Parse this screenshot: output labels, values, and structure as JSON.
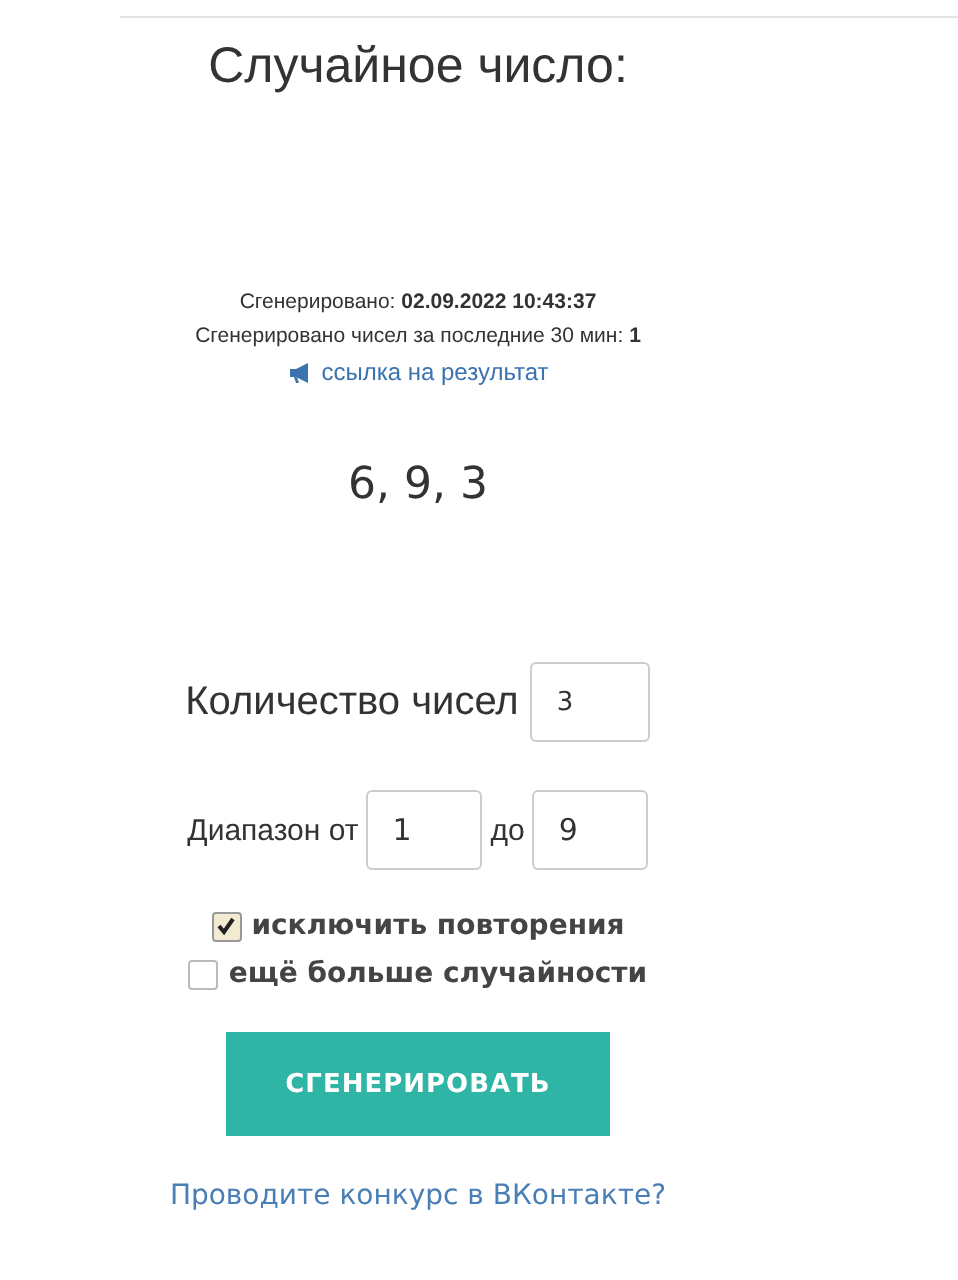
{
  "title": "Случайное число:",
  "generated": {
    "label": "Сгенерировано:",
    "value": "02.09.2022 10:43:37"
  },
  "count_30min": {
    "label": "Сгенерировано чисел за последние 30 мин:",
    "value": "1"
  },
  "result_link": "ссылка на результат",
  "result": "6, 9, 3",
  "count_field": {
    "label": "Количество чисел",
    "value": "3"
  },
  "range": {
    "label_from": "Диапазон от",
    "from": "1",
    "label_to": "до",
    "to": "9"
  },
  "options": [
    {
      "label": "исключить повторения",
      "checked": true
    },
    {
      "label": "ещё больше случайности",
      "checked": false
    }
  ],
  "generate_button": "СГЕНЕРИРОВАТЬ",
  "contest_link": "Проводите конкурс в ВКонтакте?"
}
